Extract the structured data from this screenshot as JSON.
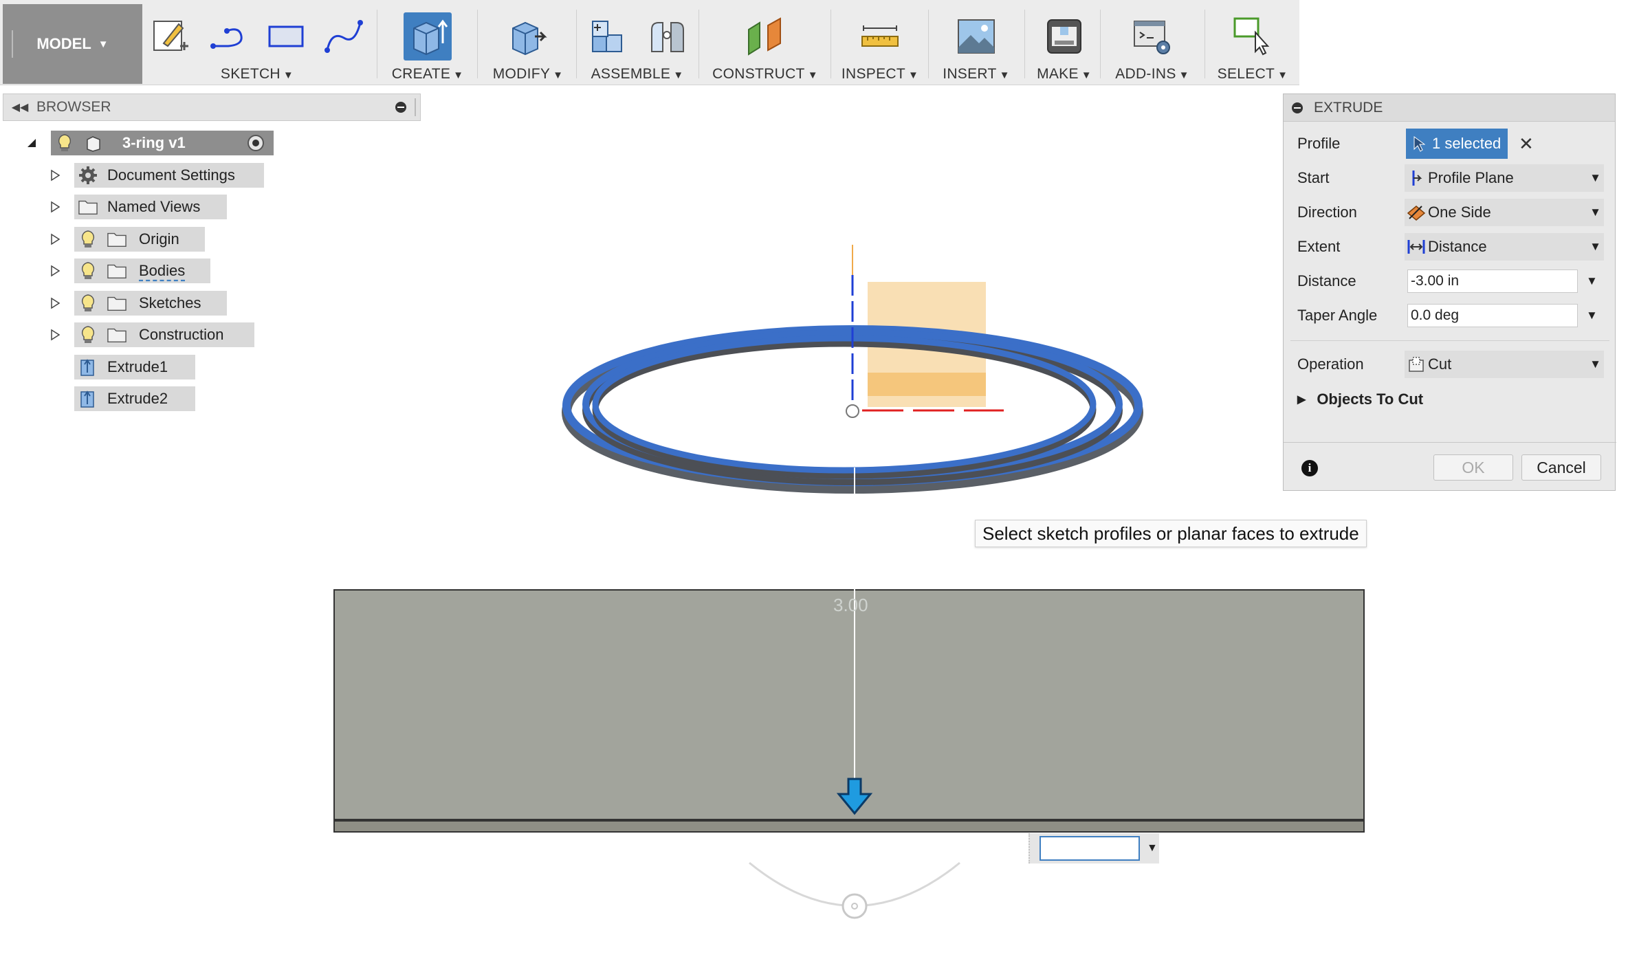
{
  "toolbar": {
    "workspace": "MODEL",
    "groups": [
      {
        "label": "SKETCH"
      },
      {
        "label": "CREATE"
      },
      {
        "label": "MODIFY"
      },
      {
        "label": "ASSEMBLE"
      },
      {
        "label": "CONSTRUCT"
      },
      {
        "label": "INSPECT"
      },
      {
        "label": "INSERT"
      },
      {
        "label": "MAKE"
      },
      {
        "label": "ADD-INS"
      },
      {
        "label": "SELECT"
      }
    ]
  },
  "browser": {
    "title": "BROWSER",
    "root": "3-ring v1",
    "items": [
      {
        "label": "Document Settings"
      },
      {
        "label": "Named Views"
      },
      {
        "label": "Origin"
      },
      {
        "label": "Bodies"
      },
      {
        "label": "Sketches"
      },
      {
        "label": "Construction"
      },
      {
        "label": "Extrude1"
      },
      {
        "label": "Extrude2"
      }
    ]
  },
  "canvas": {
    "dimension_label": "3.00",
    "tooltip": "Select sketch profiles or planar faces to extrude",
    "value_input": ""
  },
  "extrude": {
    "title": "EXTRUDE",
    "rows": {
      "profile": {
        "label": "Profile",
        "value": "1 selected"
      },
      "start": {
        "label": "Start",
        "value": "Profile Plane"
      },
      "direction": {
        "label": "Direction",
        "value": "One Side"
      },
      "extent": {
        "label": "Extent",
        "value": "Distance"
      },
      "distance": {
        "label": "Distance",
        "value": "-3.00 in"
      },
      "taper": {
        "label": "Taper Angle",
        "value": "0.0 deg"
      },
      "operation": {
        "label": "Operation",
        "value": "Cut"
      }
    },
    "objects_to_cut": "Objects To Cut",
    "ok": "OK",
    "cancel": "Cancel"
  },
  "colors": {
    "accent": "#3f7fc1",
    "ring_blue": "#3b6fc8",
    "body_gray": "#a2a49c",
    "preview_orange": "#f5c67c"
  }
}
